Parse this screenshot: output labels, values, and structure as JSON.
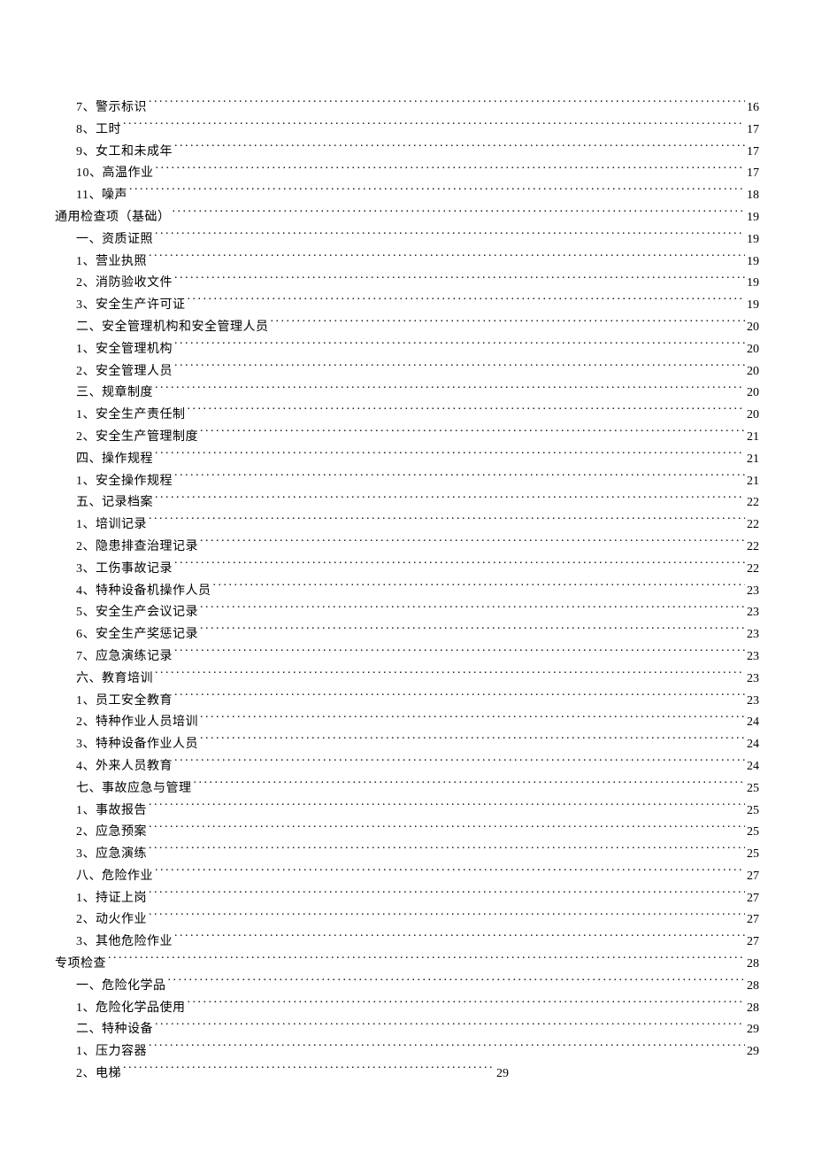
{
  "toc": [
    {
      "level": 3,
      "label": "7、警示标识",
      "page": "16"
    },
    {
      "level": 3,
      "label": "8、工时",
      "page": "17"
    },
    {
      "level": 3,
      "label": "9、女工和未成年",
      "page": "17"
    },
    {
      "level": 3,
      "label": "10、高温作业",
      "page": "17"
    },
    {
      "level": 3,
      "label": "11、噪声",
      "page": "18"
    },
    {
      "level": 1,
      "label": "通用检查项（基础）",
      "page": "19"
    },
    {
      "level": 2,
      "label": "一、资质证照",
      "page": "19"
    },
    {
      "level": 3,
      "label": "1、营业执照",
      "page": "19"
    },
    {
      "level": 3,
      "label": "2、消防验收文件",
      "page": "19"
    },
    {
      "level": 3,
      "label": "3、安全生产许可证",
      "page": "19"
    },
    {
      "level": 2,
      "label": "二、安全管理机构和安全管理人员",
      "page": "20"
    },
    {
      "level": 3,
      "label": "1、安全管理机构",
      "page": "20"
    },
    {
      "level": 3,
      "label": "2、安全管理人员",
      "page": "20"
    },
    {
      "level": 2,
      "label": "三、规章制度",
      "page": "20"
    },
    {
      "level": 3,
      "label": "1、安全生产责任制",
      "page": "20"
    },
    {
      "level": 3,
      "label": "2、安全生产管理制度",
      "page": "21"
    },
    {
      "level": 2,
      "label": "四、操作规程",
      "page": "21"
    },
    {
      "level": 3,
      "label": "1、安全操作规程",
      "page": "21"
    },
    {
      "level": 2,
      "label": "五、记录档案",
      "page": "22"
    },
    {
      "level": 3,
      "label": "1、培训记录",
      "page": "22"
    },
    {
      "level": 3,
      "label": "2、隐患排查治理记录",
      "page": "22"
    },
    {
      "level": 3,
      "label": "3、工伤事故记录",
      "page": "22"
    },
    {
      "level": 3,
      "label": "4、特种设备机操作人员",
      "page": "23"
    },
    {
      "level": 3,
      "label": "5、安全生产会议记录",
      "page": "23"
    },
    {
      "level": 3,
      "label": "6、安全生产奖惩记录",
      "page": "23"
    },
    {
      "level": 3,
      "label": "7、应急演练记录",
      "page": "23"
    },
    {
      "level": 2,
      "label": "六、教育培训",
      "page": "23"
    },
    {
      "level": 3,
      "label": "1、员工安全教育",
      "page": "23"
    },
    {
      "level": 3,
      "label": "2、特种作业人员培训",
      "page": "24"
    },
    {
      "level": 3,
      "label": "3、特种设备作业人员",
      "page": "24"
    },
    {
      "level": 3,
      "label": "4、外来人员教育",
      "page": "24"
    },
    {
      "level": 2,
      "label": "七、事故应急与管理",
      "page": "25"
    },
    {
      "level": 3,
      "label": "1、事故报告",
      "page": "25"
    },
    {
      "level": 3,
      "label": "2、应急预案",
      "page": "25"
    },
    {
      "level": 3,
      "label": "3、应急演练",
      "page": "25"
    },
    {
      "level": 2,
      "label": "八、危险作业",
      "page": "27"
    },
    {
      "level": 3,
      "label": "1、持证上岗",
      "page": "27"
    },
    {
      "level": 3,
      "label": "2、动火作业",
      "page": "27"
    },
    {
      "level": 3,
      "label": "3、其他危险作业",
      "page": "27"
    },
    {
      "level": 1,
      "label": "专项检查",
      "page": "28"
    },
    {
      "level": 2,
      "label": "一、危险化学品",
      "page": "28"
    },
    {
      "level": 3,
      "label": "1、危险化学品使用",
      "page": "28"
    },
    {
      "level": 2,
      "label": "二、特种设备",
      "page": "29"
    },
    {
      "level": 3,
      "label": "1、压力容器",
      "page": "29"
    },
    {
      "level": 3,
      "label": "2、电梯",
      "page": "29",
      "short": true
    }
  ]
}
